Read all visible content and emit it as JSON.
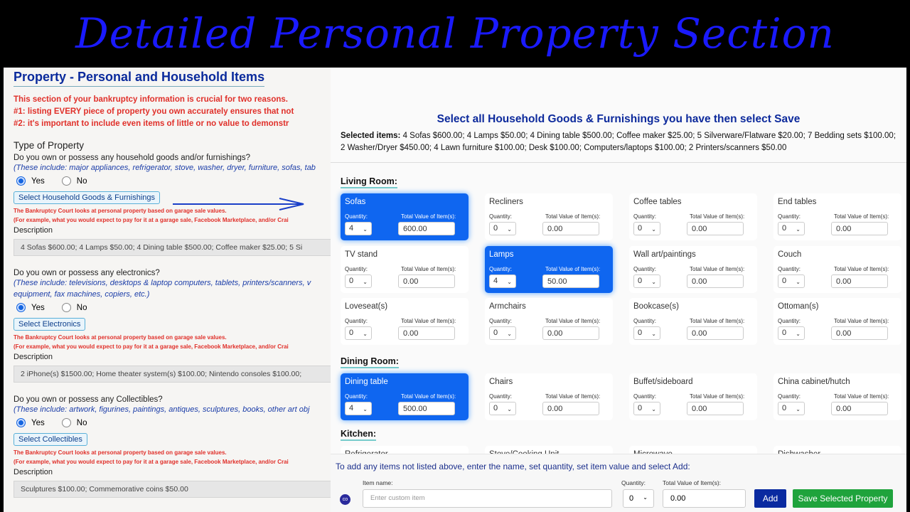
{
  "banner": {
    "title": "Detailed Personal Property Section"
  },
  "left": {
    "title": "Property - Personal and Household Items",
    "intro": [
      "This section of your bankruptcy information is crucial for two reasons.",
      "#1: listing EVERY piece of property you own accurately ensures that not",
      "#2: it's important to include even items of little or no value to demonstr"
    ],
    "type_heading": "Type of Property",
    "court_note": "The Bankruptcy Court looks at personal property based on garage sale values.",
    "court_example": "(For example, what you would expect to pay for it at a garage sale, Facebook Marketplace, and/or Crai",
    "description_label": "Description",
    "yes": "Yes",
    "no": "No",
    "sections": [
      {
        "question": "Do you own or possess any household goods and/or furnishings?",
        "hint": [
          "(These include: major appliances, refrigerator, stove, washer, dryer, furniture, sofas, tab"
        ],
        "answer": "Yes",
        "button": "Select Household Goods & Furnishings",
        "description": "4 Sofas $600.00; 4 Lamps $50.00; 4 Dining table $500.00; Coffee maker $25.00; 5 Si"
      },
      {
        "question": "Do you own or possess any electronics?",
        "hint": [
          "(These include: televisions, desktops & laptop computers, tablets, printers/scanners, v",
          "equipment, fax machines, copiers, etc.)"
        ],
        "answer": "Yes",
        "button": "Select Electronics",
        "description": "2 iPhone(s) $1500.00; Home theater system(s) $100.00; Nintendo consoles $100.00;"
      },
      {
        "question": "Do you own or possess any Collectibles?",
        "hint": [
          "(These include: artwork, figurines, paintings, antiques, sculptures, books, other art obj"
        ],
        "answer": "Yes",
        "button": "Select Collectibles",
        "description": "Sculptures $100.00; Commemorative coins $50.00"
      }
    ]
  },
  "right": {
    "title": "Select all Household Goods & Furnishings you have then select Save",
    "selected_label": "Selected items:",
    "selected_text": " 4 Sofas $600.00; 4 Lamps $50.00; 4 Dining table $500.00; Coffee maker $25.00; 5 Silverware/Flatware $20.00; 7 Bedding sets $100.00; 2 Washer/Dryer $450.00; 4 Lawn furniture $100.00; Desk $100.00; Computers/laptops $100.00; 2 Printers/scanners $50.00",
    "qty_label": "Quantity:",
    "value_label": "Total Value of Item(s):",
    "rooms": [
      {
        "name": "Living Room:",
        "items": [
          {
            "name": "Sofas",
            "qty": "4",
            "value": "600.00",
            "selected": true
          },
          {
            "name": "Recliners",
            "qty": "0",
            "value": "0.00"
          },
          {
            "name": "Coffee tables",
            "qty": "0",
            "value": "0.00"
          },
          {
            "name": "End tables",
            "qty": "0",
            "value": "0.00"
          },
          {
            "name": "TV stand",
            "qty": "0",
            "value": "0.00"
          },
          {
            "name": "Lamps",
            "qty": "4",
            "value": "50.00",
            "selected": true
          },
          {
            "name": "Wall art/paintings",
            "qty": "0",
            "value": "0.00"
          },
          {
            "name": "Couch",
            "qty": "0",
            "value": "0.00"
          },
          {
            "name": "Loveseat(s)",
            "qty": "0",
            "value": "0.00"
          },
          {
            "name": "Armchairs",
            "qty": "0",
            "value": "0.00"
          },
          {
            "name": "Bookcase(s)",
            "qty": "0",
            "value": "0.00"
          },
          {
            "name": "Ottoman(s)",
            "qty": "0",
            "value": "0.00"
          }
        ]
      },
      {
        "name": "Dining Room:",
        "items": [
          {
            "name": "Dining table",
            "qty": "4",
            "value": "500.00",
            "selected": true
          },
          {
            "name": "Chairs",
            "qty": "0",
            "value": "0.00"
          },
          {
            "name": "Buffet/sideboard",
            "qty": "0",
            "value": "0.00"
          },
          {
            "name": "China cabinet/hutch",
            "qty": "0",
            "value": "0.00"
          }
        ]
      },
      {
        "name": "Kitchen:",
        "items": [
          {
            "name": "Refrigerator"
          },
          {
            "name": "Stove/Cooking Unit"
          },
          {
            "name": "Microwave"
          },
          {
            "name": "Dishwasher"
          }
        ]
      }
    ],
    "custom": {
      "instructions": "To add any items not listed above, enter the name, set quantity, set item value and select Add:",
      "name_label": "Item name:",
      "name_placeholder": "Enter custom item",
      "qty_label": "Quantity:",
      "qty": "0",
      "value_label": "Total Value of Item(s):",
      "value": "0.00",
      "add": "Add",
      "save": "Save Selected Property"
    }
  },
  "colors": {
    "accent": "#0f66f0",
    "title_blue": "#0d2a9c",
    "warning": "#e0302a",
    "save": "#1fa33c",
    "add": "#0a2aa0"
  }
}
